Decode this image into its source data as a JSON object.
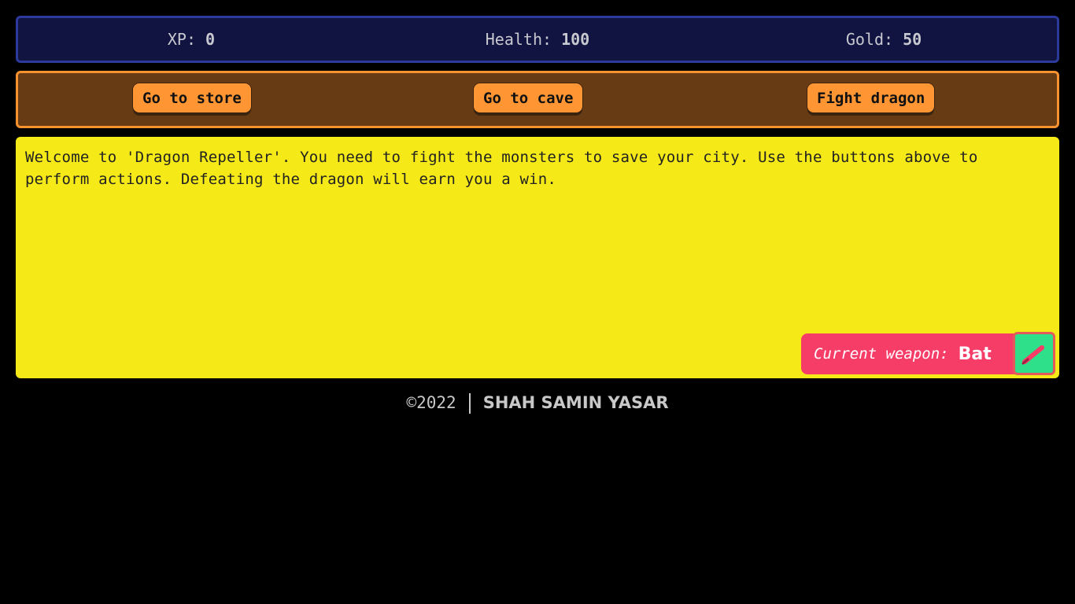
{
  "stats": {
    "xp_label": "XP:",
    "xp_value": "0",
    "health_label": "Health:",
    "health_value": "100",
    "gold_label": "Gold:",
    "gold_value": "50"
  },
  "controls": {
    "button1": "Go to store",
    "button2": "Go to cave",
    "button3": "Fight dragon"
  },
  "text": "Welcome to 'Dragon Repeller'. You need to fight the monsters to save your city. Use the buttons above to perform actions. Defeating the dragon will earn you a win.",
  "weapon": {
    "label": "Current weapon:",
    "name": "Bat",
    "icon": "bat-icon"
  },
  "footer": {
    "copyright": "©2022",
    "author": "SHAH SAMIN YASAR"
  },
  "colors": {
    "stats_bg": "#111440",
    "controls_bg": "#673b14",
    "button": "#ff9633",
    "text_bg": "#f5e917",
    "weapon_bg": "#f63d68",
    "weapon_icon_bg": "#2fe08a"
  }
}
